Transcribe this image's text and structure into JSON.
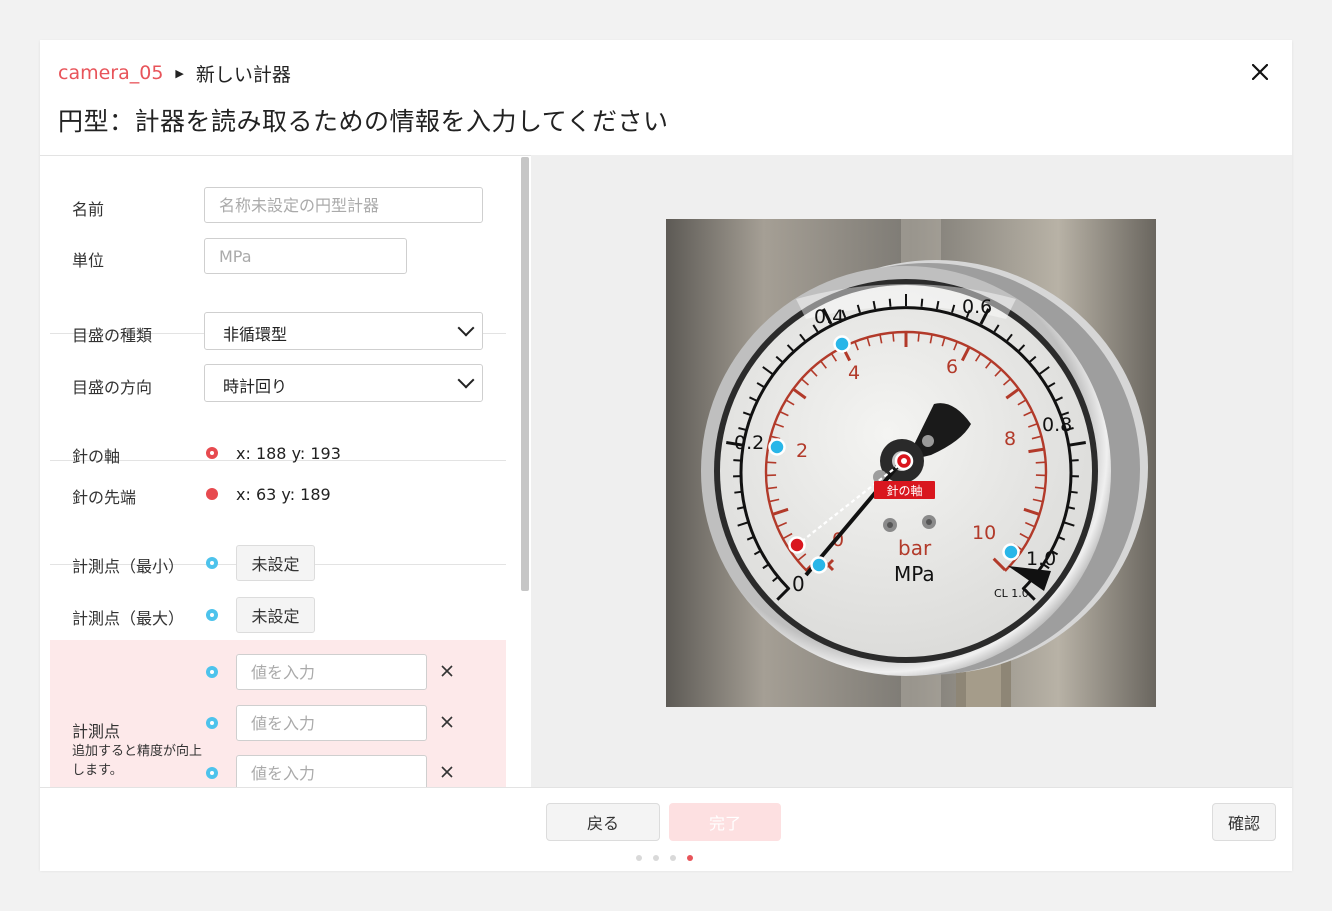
{
  "header": {
    "breadcrumb_camera": "camera_05",
    "breadcrumb_current": "新しい計器",
    "title": "円型：計器を読み取るための情報を入力してください"
  },
  "form": {
    "name_label": "名前",
    "name_placeholder": "名称未設定の円型計器",
    "unit_label": "単位",
    "unit_placeholder": "MPa",
    "scale_type_label": "目盛の種類",
    "scale_type_value": "非循環型",
    "scale_direction_label": "目盛の方向",
    "scale_direction_value": "時計回り",
    "needle_axis_label": "針の軸",
    "needle_axis_coords": "x: 188 y: 193",
    "needle_tip_label": "針の先端",
    "needle_tip_coords": "x: 63 y: 189",
    "point_min_label": "計測点（最小）",
    "point_min_button": "未設定",
    "point_max_label": "計測点（最大）",
    "point_max_button": "未設定",
    "points_label": "計測点",
    "points_note": "追加すると精度が向上します。",
    "value_placeholder": "値を入力"
  },
  "image": {
    "needle_axis_tag": "針の軸",
    "dial_labels": {
      "inner": [
        "0",
        "2",
        "4",
        "6",
        "8",
        "10"
      ],
      "outer": [
        "0",
        "0.2",
        "0.4",
        "0.6",
        "0.8",
        "1.0"
      ],
      "unit_bar": "bar",
      "unit_mpa": "MPa",
      "class": "CL 1.0"
    }
  },
  "footer": {
    "back_label": "戻る",
    "done_label": "完了",
    "confirm_label": "確認",
    "current_step": 4,
    "total_steps": 4
  },
  "colors": {
    "accent": "#e8545a",
    "point_blue": "#29b6e8",
    "needle_red": "#d9161e",
    "done_disabled": "#fde0e1",
    "highlight_row": "#fde9ea"
  }
}
